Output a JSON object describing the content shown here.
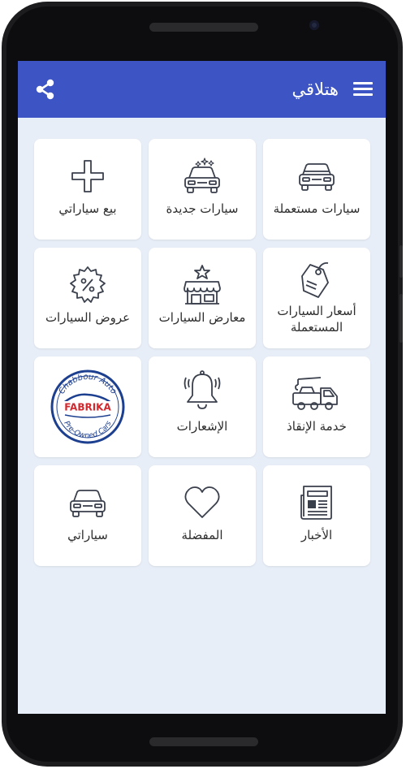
{
  "app": {
    "title": "هتلاقي"
  },
  "colors": {
    "appbar": "#3d55c4",
    "background": "#e8eef7",
    "tile": "#ffffff",
    "icon_stroke": "#3a3f4c",
    "brand_red": "#d3272e",
    "brand_blue": "#1d3f8f"
  },
  "tiles": [
    {
      "label": "سيارات مستعملة",
      "icon": "used-car-icon"
    },
    {
      "label": "سيارات جديدة",
      "icon": "new-car-sparkle-icon"
    },
    {
      "label": "بيع سياراتي",
      "icon": "plus-icon"
    },
    {
      "label_line1": "أسعار السيارات",
      "label_line2": "المستعملة",
      "icon": "price-tag-icon"
    },
    {
      "label": "معارض السيارات",
      "icon": "showroom-store-icon"
    },
    {
      "label": "عروض السيارات",
      "icon": "discount-badge-icon"
    },
    {
      "label": "خدمة الإنقاذ",
      "icon": "tow-truck-icon"
    },
    {
      "label": "الإشعارات",
      "icon": "bell-icon"
    },
    {
      "logo_text": "FABRIKA",
      "logo_top": "Chabbour Auto",
      "logo_bottom": "Pre-Owned Cars",
      "icon": "fabrika-logo"
    },
    {
      "label": "الأخبار",
      "icon": "newspaper-icon"
    },
    {
      "label": "المفضلة",
      "icon": "heart-icon"
    },
    {
      "label": "سياراتي",
      "icon": "my-car-icon"
    }
  ]
}
